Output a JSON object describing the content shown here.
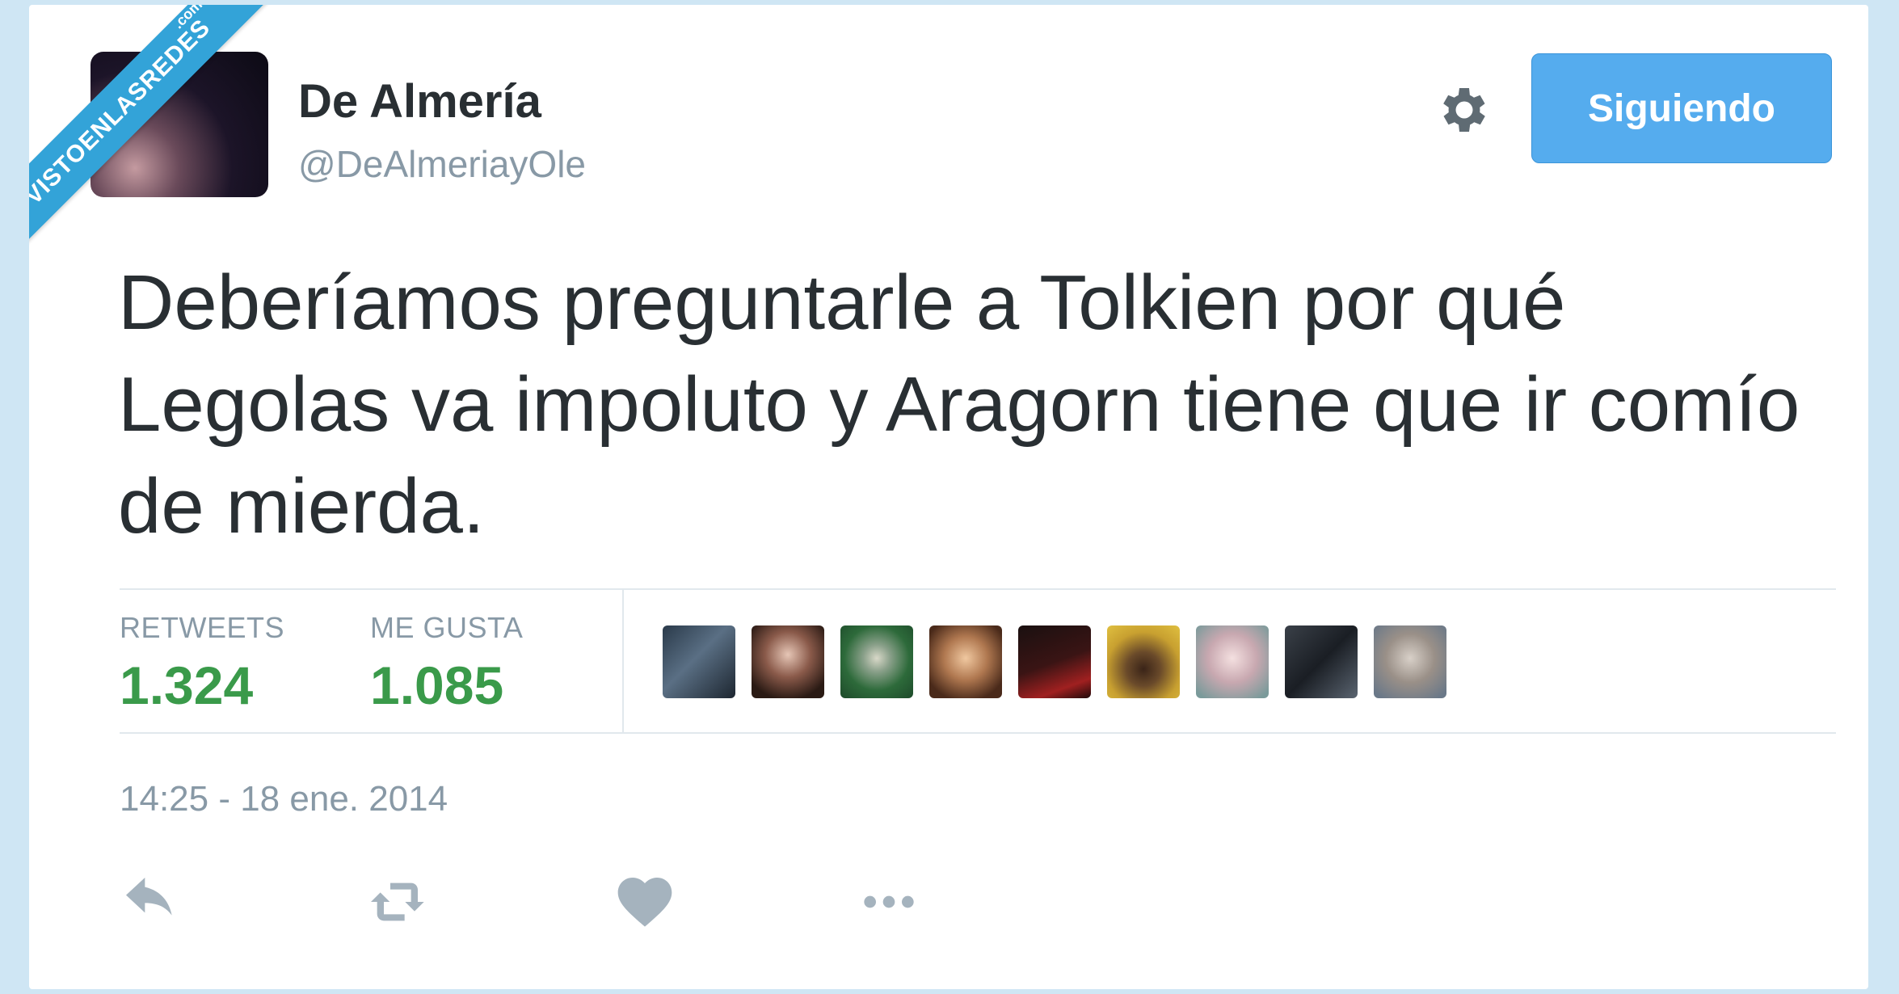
{
  "watermark": {
    "main": "VISTOENLASREDES",
    "sub": ".com"
  },
  "tweet": {
    "display_name": "De Almería",
    "handle": "@DeAlmeriayOle",
    "follow_button": "Siguiendo",
    "text": "Deberíamos preguntarle a Tolkien por qué Legolas va impoluto y Aragorn tiene que ir comío de mierda.",
    "stats": {
      "retweets_label": "RETWEETS",
      "retweets_value": "1.324",
      "likes_label": "ME GUSTA",
      "likes_value": "1.085"
    },
    "timestamp": "14:25 - 18 ene. 2014"
  },
  "colors": {
    "page_bg": "#cfe6f4",
    "follow_blue": "#55acee",
    "stat_green": "#3a9a4a",
    "muted_gray": "#8899a6",
    "text_dark": "#292f33"
  },
  "icons": {
    "settings": "gear-icon",
    "reply": "reply-icon",
    "retweet": "retweet-icon",
    "like": "heart-icon",
    "more": "more-icon"
  }
}
